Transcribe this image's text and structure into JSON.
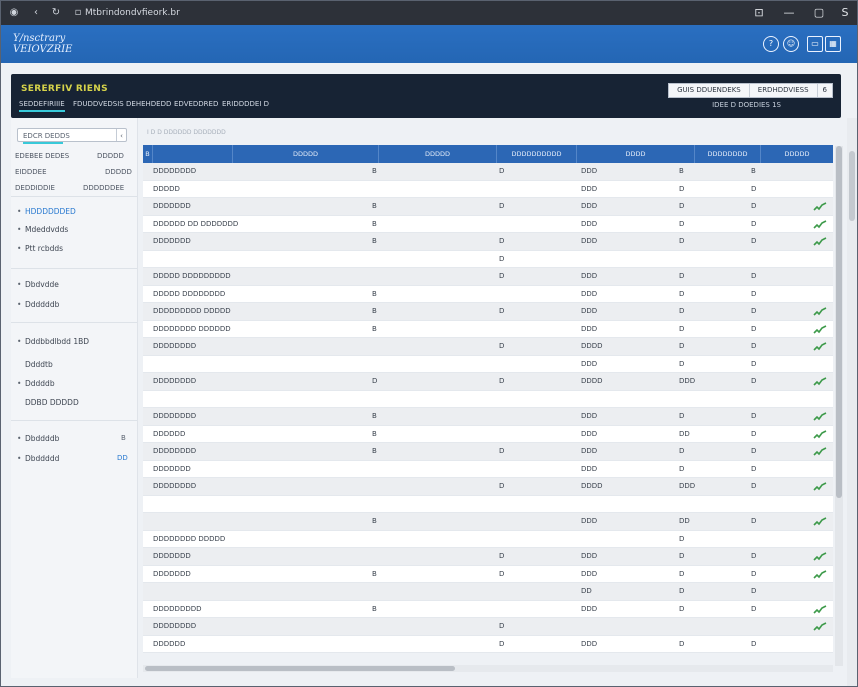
{
  "browser": {
    "url": "Mtbrindondvfieork.br",
    "controls": {
      "tab_icon": "⊡",
      "minimize": "—",
      "maximize": "▢",
      "close": "S"
    }
  },
  "app": {
    "logo_line1": "Y/nsctrary",
    "logo_line2": "VEIOVZRIE"
  },
  "banner": {
    "title": "SERERFIV RIENS",
    "tabs": [
      {
        "label": "SEDDEFIRIIIE"
      },
      {
        "label": "FDUDDVEDSIS"
      },
      {
        "label": "DEHEHDEDD"
      },
      {
        "label": "EDVEDDRED"
      },
      {
        "label": "ERIDDDDEI D"
      }
    ],
    "buttons": [
      {
        "label": "GUIS DDUENDEKS"
      },
      {
        "label": "ERDHDDVIESS"
      },
      {
        "label": "6"
      }
    ],
    "subtitle": "IDEE D DOEDIES  1S"
  },
  "sidebar": {
    "search_value": "EDCR DEDDS",
    "stats": [
      {
        "label": "EDEBEE DEDES",
        "value": "DDDDD"
      },
      {
        "label": "EIDDDEE",
        "value": "DDDDD"
      },
      {
        "label": "DEDDIDDIE",
        "value": "DDDDDDEE"
      }
    ],
    "items": [
      {
        "label": "HDDDDDDED",
        "bullet": "•"
      },
      {
        "label": "Mdeddvdds",
        "bullet": "•"
      },
      {
        "label": "Ptt rcbdds",
        "bullet": "•"
      },
      {
        "label": "Dbdvdde",
        "bullet": "•"
      },
      {
        "label": "Ddddddb",
        "bullet": "•"
      },
      {
        "label": "Dddbbdlbdd 1BD",
        "bullet": "•"
      },
      {
        "label": "Ddddtb",
        "bullet": ""
      },
      {
        "label": "Dddddb",
        "bullet": "•"
      },
      {
        "label": "DDBD DDDDD",
        "bullet": ""
      },
      {
        "label": "Dbddddb",
        "bullet": "•"
      },
      {
        "label": "Dbddddd",
        "bullet": "•"
      }
    ],
    "badges": [
      "B",
      "DD"
    ]
  },
  "table": {
    "filter_text": "I D D DDDDDD DDDDDDD",
    "columns": [
      "B",
      "DDDDD",
      "DDDDD",
      "DDDDDDDDDD",
      "DDDD",
      "DDDDDDDD",
      "DDDDD"
    ],
    "rows": [
      {
        "name": "DDDDDDDD",
        "a": "B",
        "b": "D",
        "c": "DDD",
        "d": "B",
        "e": "B",
        "spark": ""
      },
      {
        "name": "DDDDD",
        "a": "",
        "b": "",
        "c": "DDD",
        "d": "D",
        "e": "D",
        "spark": ""
      },
      {
        "name": "DDDDDDD",
        "a": "B",
        "b": "D",
        "c": "DDD",
        "d": "D",
        "e": "D",
        "spark": "up"
      },
      {
        "name": "DDDDDD DD DDDDDDD",
        "a": "B",
        "b": "",
        "c": "DDD",
        "d": "D",
        "e": "D",
        "spark": "up"
      },
      {
        "name": "DDDDDDD",
        "a": "B",
        "b": "D",
        "c": "DDD",
        "d": "D",
        "e": "D",
        "spark": "up"
      },
      {
        "name": "",
        "a": "",
        "b": "D",
        "c": "",
        "d": "",
        "e": "",
        "spark": ""
      },
      {
        "name": "DDDDD DDDDDDDDD",
        "a": "",
        "b": "D",
        "c": "DDD",
        "d": "D",
        "e": "D",
        "spark": ""
      },
      {
        "name": "DDDDD DDDDDDDD",
        "a": "B",
        "b": "",
        "c": "DDD",
        "d": "D",
        "e": "D",
        "spark": ""
      },
      {
        "name": "DDDDDDDDD DDDDD",
        "a": "B",
        "b": "D",
        "c": "DDD",
        "d": "D",
        "e": "D",
        "spark": "up"
      },
      {
        "name": "DDDDDDDD DDDDDD",
        "a": "B",
        "b": "",
        "c": "DDD",
        "d": "D",
        "e": "D",
        "spark": "up"
      },
      {
        "name": "DDDDDDDD",
        "a": "",
        "b": "D",
        "c": "DDDD",
        "d": "D",
        "e": "D",
        "spark": "up"
      },
      {
        "name": "",
        "a": "",
        "b": "",
        "c": "DDD",
        "d": "D",
        "e": "D",
        "spark": ""
      },
      {
        "name": "DDDDDDDD",
        "a": "D",
        "b": "D",
        "c": "DDDD",
        "d": "DDD",
        "e": "D",
        "spark": "up"
      },
      {
        "name": "",
        "a": "",
        "b": "",
        "c": "",
        "d": "",
        "e": "",
        "spark": ""
      },
      {
        "name": "DDDDDDDD",
        "a": "B",
        "b": "",
        "c": "DDD",
        "d": "D",
        "e": "D",
        "spark": "up"
      },
      {
        "name": "DDDDDD",
        "a": "B",
        "b": "",
        "c": "DDD",
        "d": "DD",
        "e": "D",
        "spark": "up"
      },
      {
        "name": "DDDDDDDD",
        "a": "B",
        "b": "D",
        "c": "DDD",
        "d": "D",
        "e": "D",
        "spark": "up"
      },
      {
        "name": "DDDDDDD",
        "a": "",
        "b": "",
        "c": "DDD",
        "d": "D",
        "e": "D",
        "spark": ""
      },
      {
        "name": "DDDDDDDD",
        "a": "",
        "b": "D",
        "c": "DDDD",
        "d": "DDD",
        "e": "D",
        "spark": "up"
      },
      {
        "name": "",
        "a": "",
        "b": "",
        "c": "",
        "d": "",
        "e": "",
        "spark": ""
      },
      {
        "name": "",
        "a": "B",
        "b": "",
        "c": "DDD",
        "d": "DD",
        "e": "D",
        "spark": "up"
      },
      {
        "name": "DDDDDDDD DDDDD",
        "a": "",
        "b": "",
        "c": "",
        "d": "D",
        "e": "",
        "spark": ""
      },
      {
        "name": "DDDDDDD",
        "a": "",
        "b": "D",
        "c": "DDD",
        "d": "D",
        "e": "D",
        "spark": "up"
      },
      {
        "name": "DDDDDDD",
        "a": "B",
        "b": "D",
        "c": "DDD",
        "d": "D",
        "e": "D",
        "spark": "up"
      },
      {
        "name": "",
        "a": "",
        "b": "",
        "c": "DD",
        "d": "D",
        "e": "D",
        "spark": ""
      },
      {
        "name": "DDDDDDDDD",
        "a": "B",
        "b": "",
        "c": "DDD",
        "d": "D",
        "e": "D",
        "spark": "up"
      },
      {
        "name": "DDDDDDDD",
        "a": "",
        "b": "D",
        "c": "",
        "d": "",
        "e": "",
        "spark": "up"
      },
      {
        "name": "DDDDDD",
        "a": "",
        "b": "D",
        "c": "DDD",
        "d": "D",
        "e": "D",
        "spark": ""
      }
    ],
    "colors": {
      "header": "#2c67b5",
      "spark": "#3d9a4a"
    }
  }
}
